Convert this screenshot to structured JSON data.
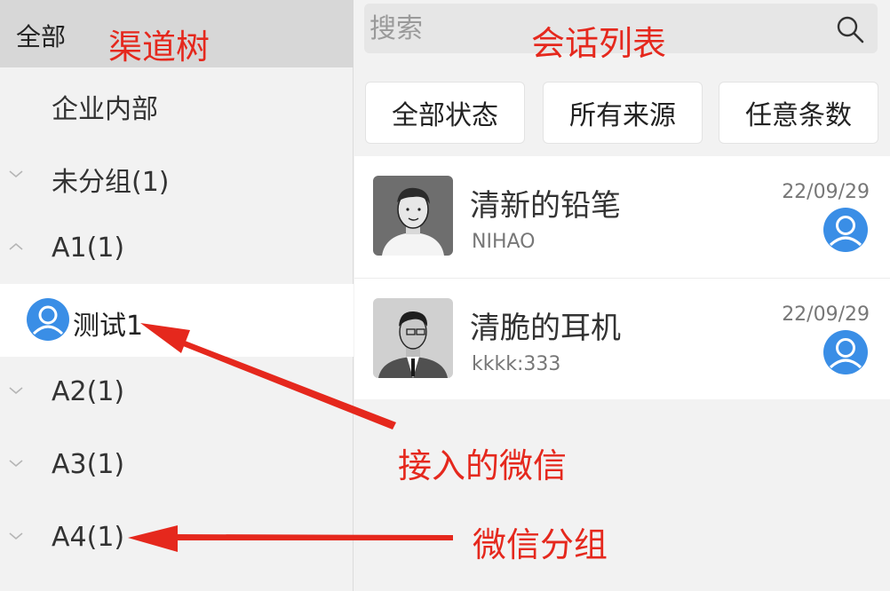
{
  "channel_tree": {
    "header_title": "全部",
    "items": [
      {
        "label": "企业内部",
        "state": "none"
      },
      {
        "label": "未分组(1)",
        "state": "collapsed"
      },
      {
        "label": "A1(1)",
        "state": "expanded"
      },
      {
        "label": "测试1",
        "state": "leaf-selected"
      },
      {
        "label": "A2(1)",
        "state": "collapsed"
      },
      {
        "label": "A3(1)",
        "state": "collapsed"
      },
      {
        "label": "A4(1)",
        "state": "collapsed"
      }
    ]
  },
  "search": {
    "placeholder": "搜索",
    "icon": "search-icon"
  },
  "filters": [
    "全部状态",
    "所有来源",
    "任意条数"
  ],
  "conversations": [
    {
      "name": "清新的铅笔",
      "message": "NIHAO",
      "date": "22/09/29"
    },
    {
      "name": "清脆的耳机",
      "message": "kkkk:333",
      "date": "22/09/29"
    }
  ],
  "annotations": {
    "channel_tree": "渠道树",
    "conversation_list": "会话列表",
    "connected_wechat": "接入的微信",
    "wechat_group": "微信分组"
  },
  "colors": {
    "annotation_red": "#e5281d",
    "avatar_blue": "#3a8ee6",
    "header_gray": "#d7d7d7"
  }
}
